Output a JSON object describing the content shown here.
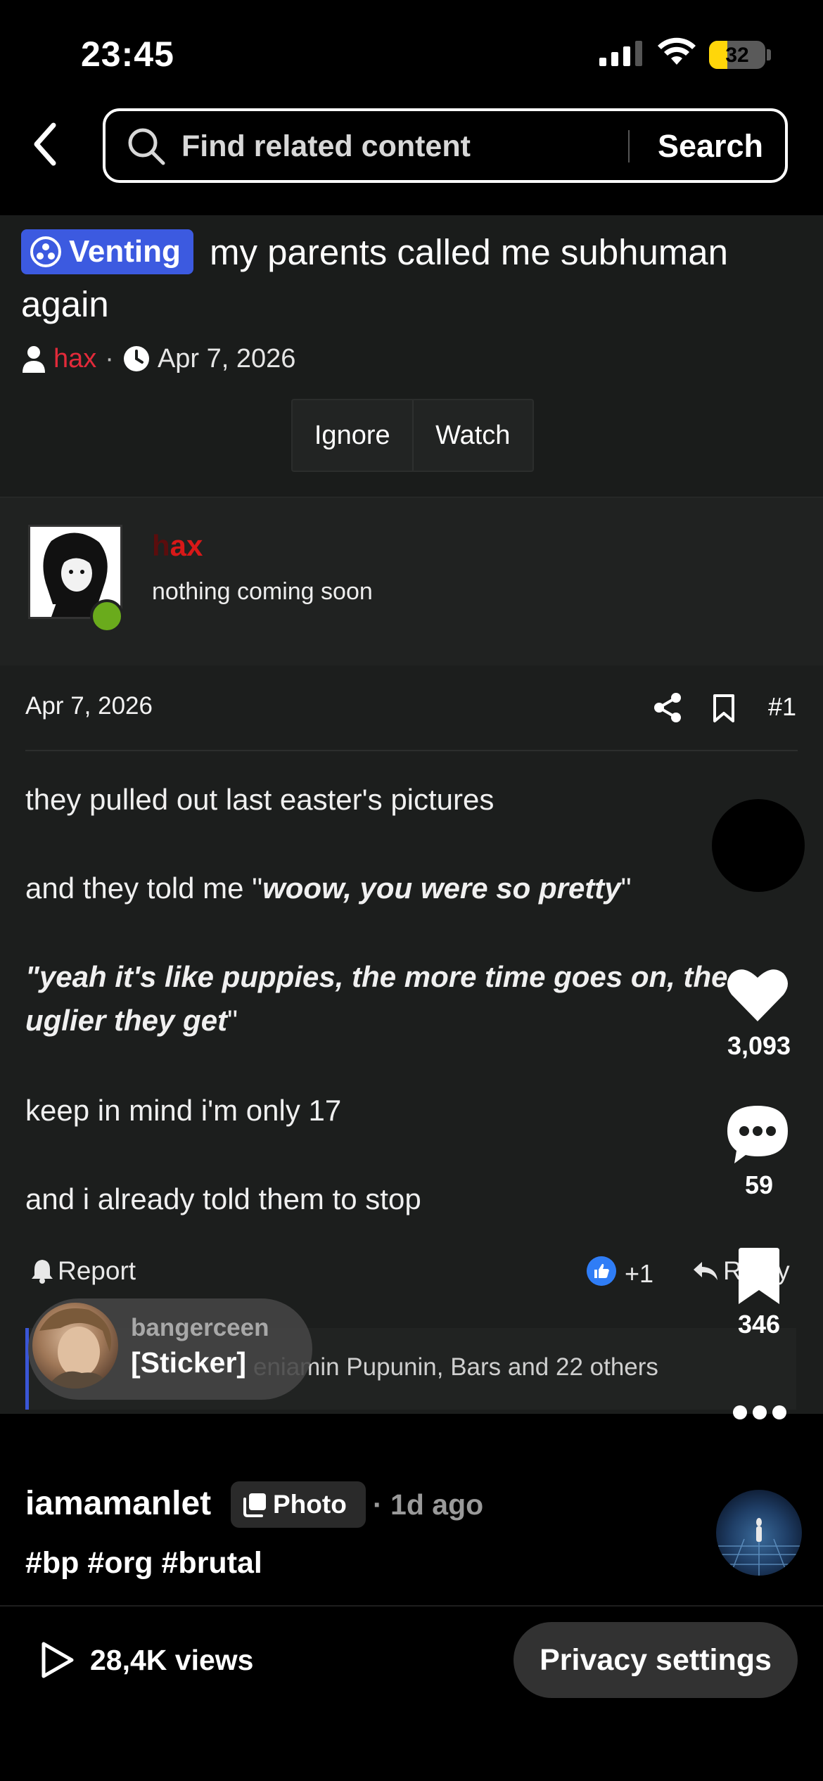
{
  "status_bar": {
    "time": "23:45",
    "battery": "32",
    "battery_level": 0.32
  },
  "search": {
    "placeholder": "Find related content",
    "button_label": "Search"
  },
  "thread": {
    "prefix": "Venting",
    "title": "my parents called me subhuman again",
    "author": "hax",
    "date": "Apr 7, 2026",
    "actions": {
      "ignore": "Ignore",
      "watch": "Watch"
    }
  },
  "user": {
    "name_prefix": "h",
    "name_suffix": "ax",
    "status": "nothing coming soon",
    "online": true
  },
  "post": {
    "date": "Apr 7, 2026",
    "number": "#1",
    "line1": "they pulled out last easter's pictures",
    "line2_pre": "and they told me \"",
    "line2_em": "woow, you were so pretty",
    "line2_post": "\"",
    "line3_em": "\"yeah it's like puppies, the more time goes on, the uglier they get",
    "line3_post": "\"",
    "line4": "keep in mind i'm only 17",
    "line5": "and i already told them to stop",
    "report": "Report",
    "reaction_count": "+1",
    "reply": "Reply",
    "reactions_text": "eniamin Pupunin, Bars and 22 others"
  },
  "sticker_preview": {
    "user": "bangerceen",
    "text": "[Sticker]"
  },
  "side_rail": {
    "likes": "3,093",
    "comments": "59",
    "saves": "346"
  },
  "caption": {
    "user": "iamamanlet",
    "type": "Photo",
    "time": "· 1d ago",
    "tags": "#bp #org #brutal"
  },
  "footer": {
    "views": "28,4K views",
    "privacy_button": "Privacy settings"
  },
  "colors": {
    "prefix": "#3c5ae0",
    "author": "#e22a3a",
    "online": "#6aab1c",
    "like_badge": "#2f7df6"
  }
}
